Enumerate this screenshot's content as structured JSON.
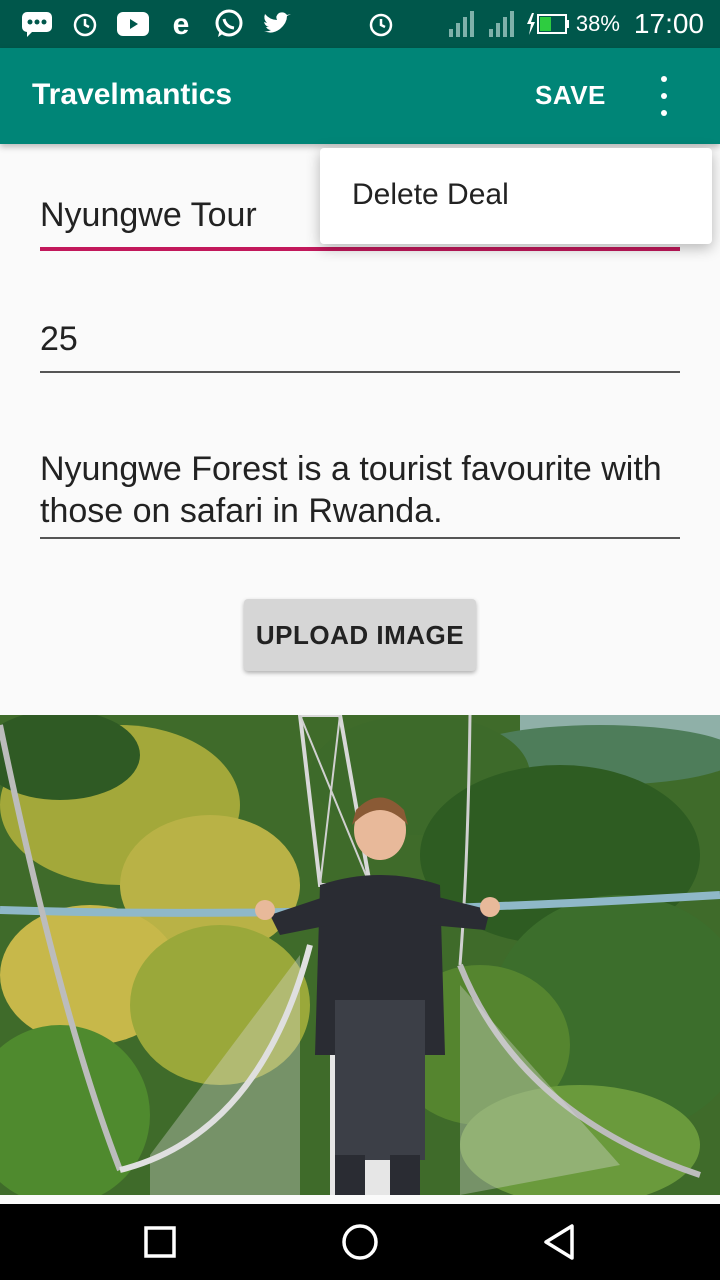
{
  "status_bar": {
    "left_icons": [
      "messages-icon",
      "alarm-icon",
      "youtube-icon",
      "browser-e-icon",
      "whatsapp-icon",
      "twitter-icon"
    ],
    "right_icons": [
      "alarm-icon",
      "wifi-icon",
      "signal-icon",
      "signal-icon"
    ],
    "battery_percent": "38%",
    "time": "17:00"
  },
  "app_bar": {
    "title": "Travelmantics",
    "save_label": "SAVE"
  },
  "overflow_menu": {
    "items": [
      {
        "label": "Delete Deal"
      }
    ]
  },
  "form": {
    "title_value": "Nyungwe Tour",
    "price_value": "25",
    "description_value": "Nyungwe Forest is a tourist favourite with those on safari in Rwanda.",
    "upload_label": "UPLOAD IMAGE"
  },
  "colors": {
    "status_bar": "#00574b",
    "app_bar": "#008577",
    "accent": "#c2185b"
  },
  "nav_bar": {
    "buttons": [
      "recents-icon",
      "home-icon",
      "back-icon"
    ]
  }
}
